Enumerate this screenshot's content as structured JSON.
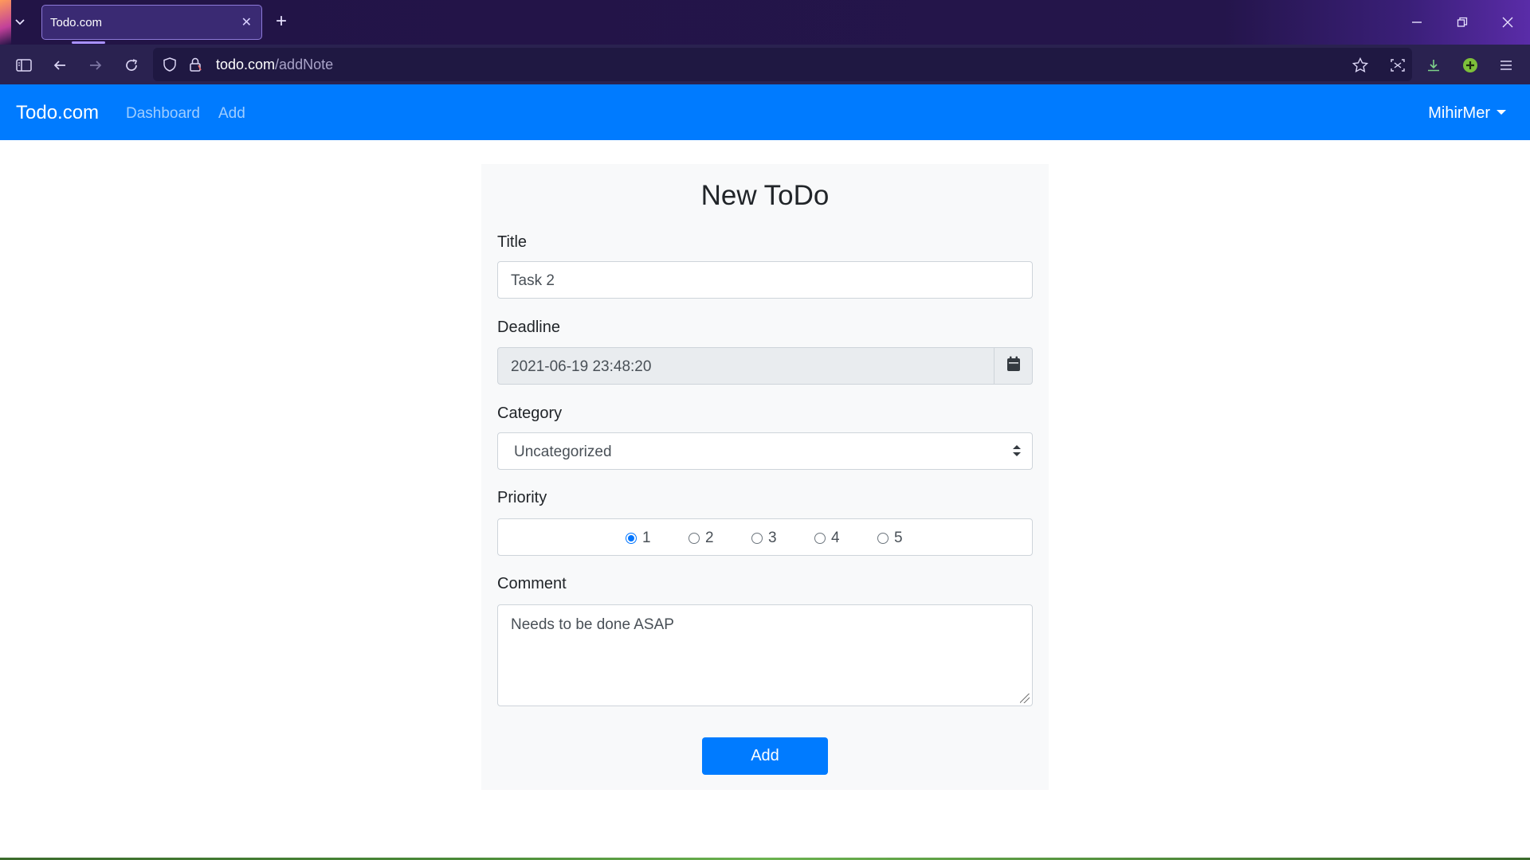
{
  "browser": {
    "tab_title": "Todo.com",
    "url_host": "todo.com",
    "url_path": "/addNote",
    "icons": {
      "tab_list": "chevron-down-icon",
      "tab_close": "close-icon",
      "new_tab": "plus-icon",
      "minimize": "minimize-icon",
      "restore": "restore-icon",
      "close_window": "close-icon",
      "sidebar": "sidebar-icon",
      "back": "back-arrow-icon",
      "forward": "forward-arrow-icon",
      "reload": "reload-icon",
      "shield": "shield-icon",
      "lock": "lock-icon",
      "bookmark": "star-icon",
      "screenshot": "screenshot-icon",
      "downloads": "download-icon",
      "extension": "extension-icon",
      "menu": "hamburger-menu-icon"
    }
  },
  "app_nav": {
    "brand": "Todo.com",
    "links": [
      "Dashboard",
      "Add"
    ],
    "user": "MihirMer"
  },
  "form": {
    "heading": "New ToDo",
    "title_label": "Title",
    "title_value": "Task 2",
    "deadline_label": "Deadline",
    "deadline_value": "2021-06-19 23:48:20",
    "calendar_icon": "calendar-icon",
    "category_label": "Category",
    "category_value": "Uncategorized",
    "priority_label": "Priority",
    "priority_options": [
      "1",
      "2",
      "3",
      "4",
      "5"
    ],
    "priority_selected": "1",
    "comment_label": "Comment",
    "comment_value": "Needs to be done ASAP",
    "submit_label": "Add"
  },
  "colors": {
    "navbar": "#007bff",
    "button": "#007bff",
    "card_bg": "#f8f9fa",
    "browser_chrome": "#221446"
  }
}
